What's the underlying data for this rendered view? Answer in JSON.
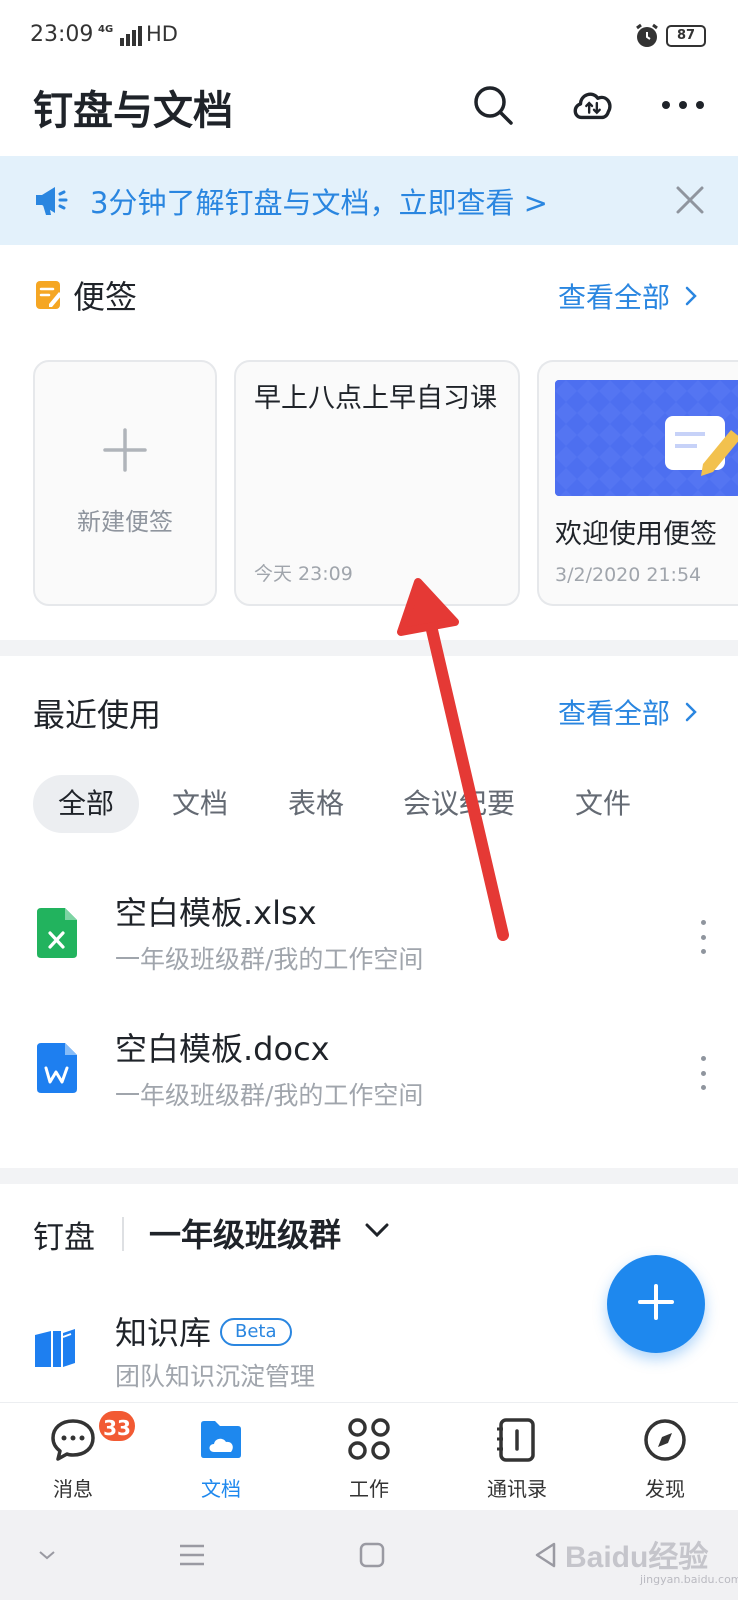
{
  "status_bar": {
    "time": "23:09",
    "network": "4G",
    "hd": "HD",
    "battery": "87"
  },
  "header": {
    "title": "钉盘与文档"
  },
  "banner": {
    "text": "3分钟了解钉盘与文档，立即查看 >"
  },
  "memos": {
    "title": "便签",
    "view_all": "查看全部",
    "new_label": "新建便签",
    "items": [
      {
        "text": "早上八点上早自习课",
        "time": "今天 23:09"
      },
      {
        "text": "欢迎使用便签",
        "time": "3/2/2020 21:54"
      }
    ]
  },
  "recent": {
    "title": "最近使用",
    "view_all": "查看全部",
    "filters": [
      "全部",
      "文档",
      "表格",
      "会议纪要",
      "文件"
    ],
    "files": [
      {
        "name": "空白模板.xlsx",
        "path": "一年级班级群/我的工作空间",
        "icon": "excel-file-icon"
      },
      {
        "name": "空白模板.docx",
        "path": "一年级班级群/我的工作空间",
        "icon": "word-file-icon"
      }
    ]
  },
  "disk": {
    "label": "钉盘",
    "group": "一年级班级群",
    "kb_title": "知识库",
    "kb_badge": "Beta",
    "kb_sub": "团队知识沉淀管理"
  },
  "tabbar": {
    "active": "文档",
    "tabs": [
      {
        "label": "消息",
        "badge": "33"
      },
      {
        "label": "文档"
      },
      {
        "label": "工作"
      },
      {
        "label": "通讯录"
      },
      {
        "label": "发现"
      }
    ]
  },
  "watermark": {
    "text": "Baidu经验",
    "sub": "jingyan.baidu.com"
  },
  "colors": {
    "accent": "#1e88ee",
    "link": "#2a86e0",
    "badge": "#f25a33",
    "annotation_arrow": "#e53935"
  }
}
